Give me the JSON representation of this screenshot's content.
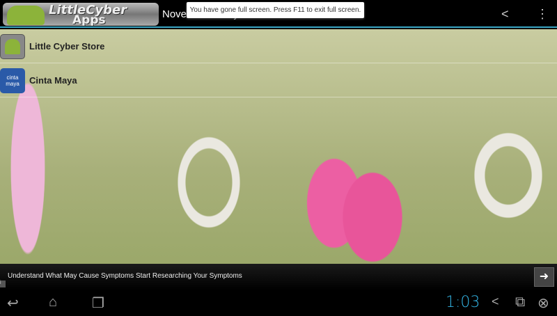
{
  "actionbar": {
    "logo_line1": "LittleCyber",
    "logo_line2": "Apps",
    "title": "Novel Cinta Maya"
  },
  "toast": "You have gone full screen. Press F11 to exit full screen.",
  "list": [
    {
      "label": "Little Cyber Store",
      "icon": "little-cyber-store-icon"
    },
    {
      "label": "Cinta Maya",
      "icon_text": "cinta maya"
    }
  ],
  "ad": {
    "text": "Understand What May Cause Symptoms Start Researching Your Symptoms"
  },
  "statusbar": {
    "time": "1:03"
  },
  "colors": {
    "accent": "#33b5e5",
    "divider": "#3aa6c4"
  }
}
